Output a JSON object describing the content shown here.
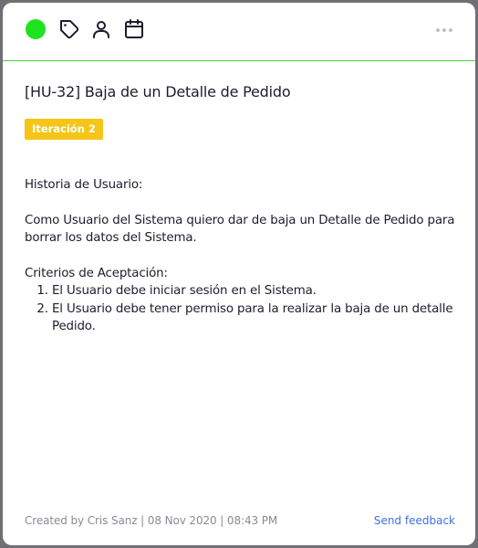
{
  "toolbar": {
    "status_color": "#1ee31e",
    "icons": [
      "tag-icon",
      "user-icon",
      "calendar-icon"
    ],
    "more_icon": "more-horizontal-icon"
  },
  "card": {
    "title": "[HU-32] Baja de un Detalle de Pedido",
    "badge": "Iteración 2",
    "badge_color": "#f5c518",
    "description": {
      "heading": "Historia de Usuario:",
      "story": "Como Usuario del Sistema quiero dar de baja un Detalle de Pedido para borrar los datos del Sistema.",
      "criteria_heading": "Criterios de Aceptación:",
      "criteria": [
        "El Usuario debe iniciar sesión en el Sistema.",
        "El Usuario debe tener permiso para la realizar la baja de un detalle Pedido."
      ]
    }
  },
  "footer": {
    "meta": "Created by Cris Sanz | 08 Nov 2020 | 08:43 PM",
    "feedback_label": "Send feedback"
  }
}
